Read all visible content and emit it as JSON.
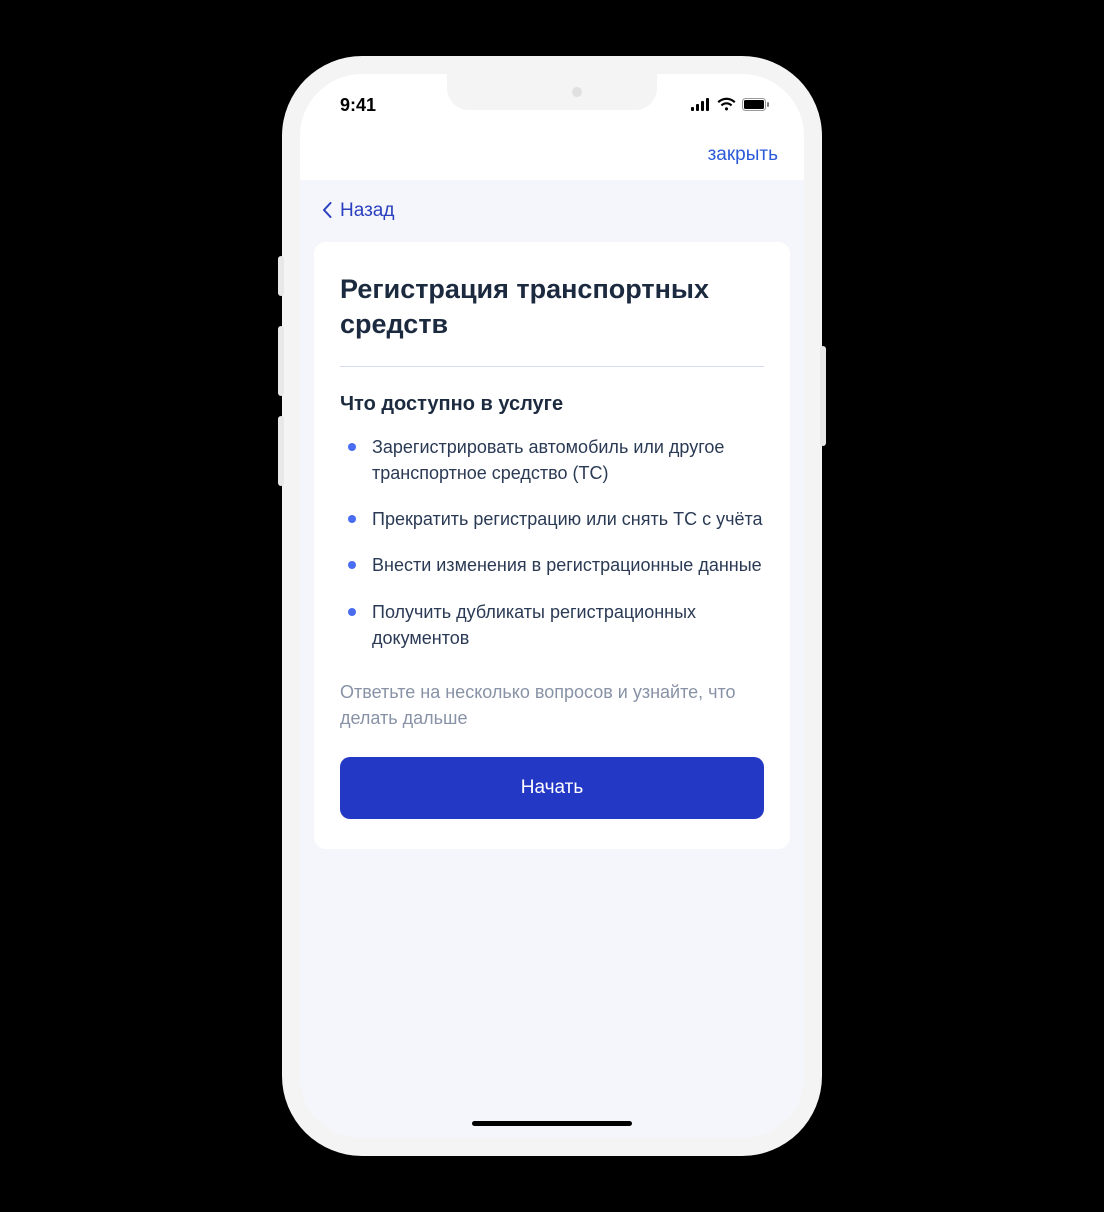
{
  "status_bar": {
    "time": "9:41"
  },
  "header": {
    "close_label": "закрыть",
    "back_label": "Назад"
  },
  "card": {
    "title": "Регистрация транспортных средств",
    "section_heading": "Что доступно в услуге",
    "bullets": [
      "Зарегистрировать автомобиль или другое транспортное средство (ТС)",
      "Прекратить регистрацию или снять ТС с учёта",
      "Внести изменения в регистрационные данные",
      "Получить дубликаты регистрационных документов"
    ],
    "hint": "Ответьте на несколько вопросов и узнайте, что делать дальше",
    "start_label": "Начать"
  },
  "colors": {
    "accent": "#2438c6",
    "link": "#2a5ad7",
    "text": "#1c2a3f",
    "muted": "#8892a6",
    "content_bg": "#f4f6fb"
  }
}
